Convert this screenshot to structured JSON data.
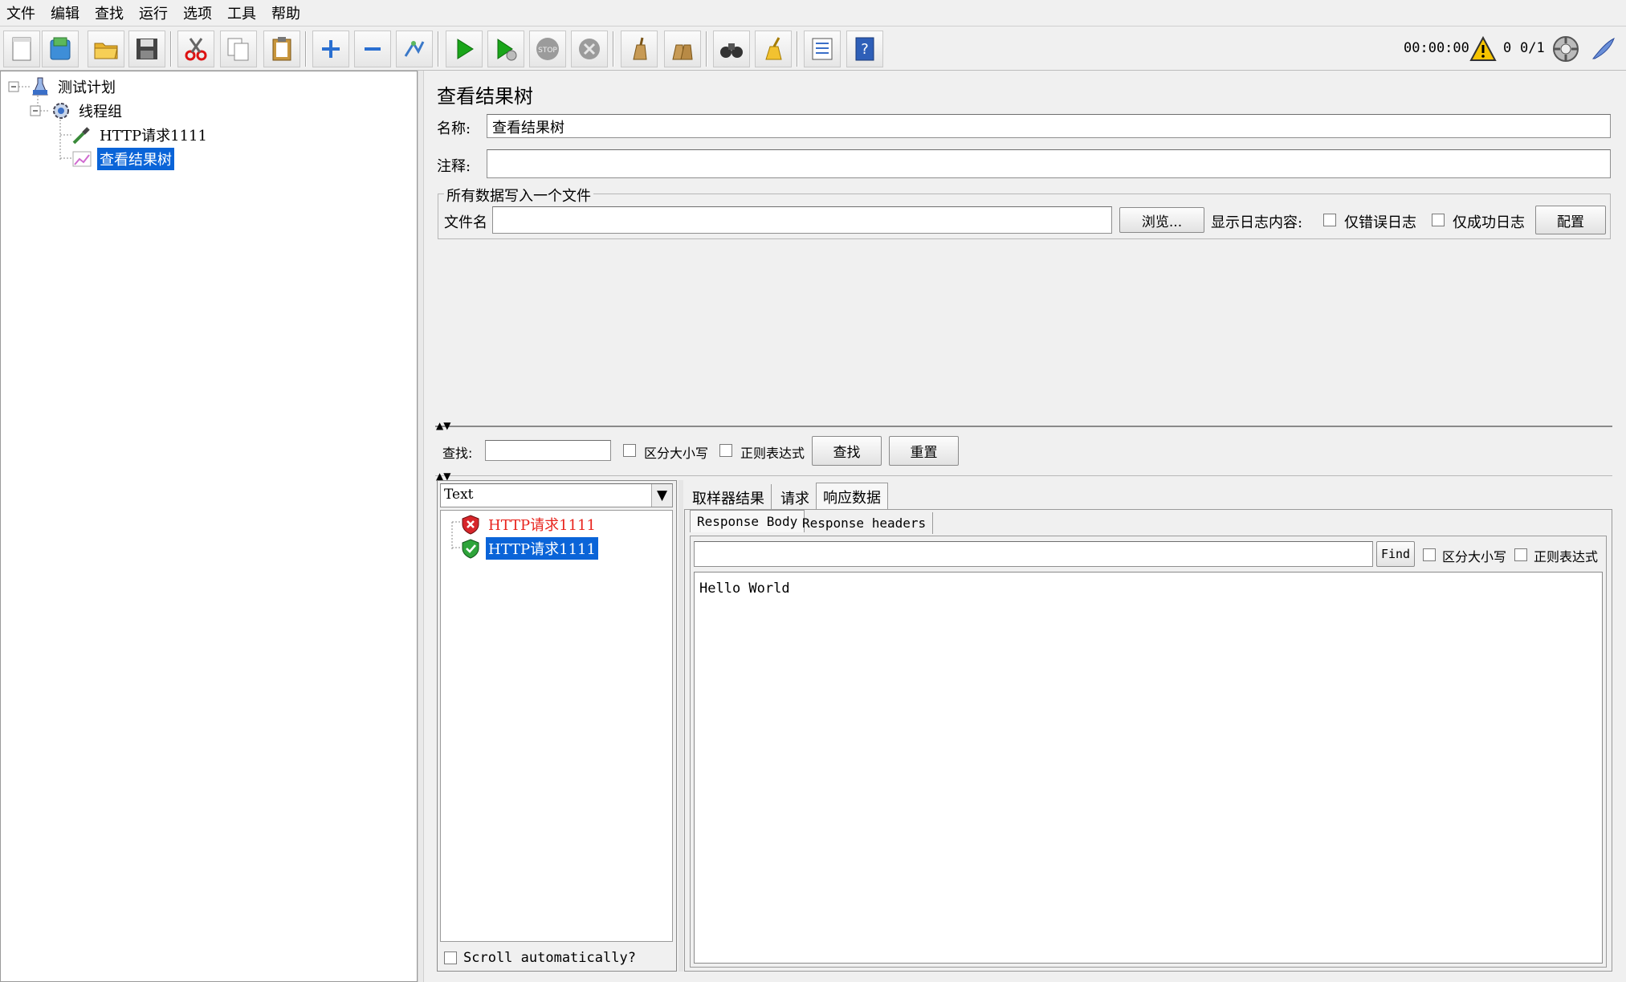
{
  "menu": [
    "文件",
    "编辑",
    "查找",
    "运行",
    "选项",
    "工具",
    "帮助"
  ],
  "toolbar": {
    "timer": "00:00:00",
    "warn_count": "0",
    "threads": "0/1"
  },
  "tree": {
    "test_plan": "测试计划",
    "thread_group": "线程组",
    "http_request": "HTTP请求1111",
    "result_tree": "查看结果树"
  },
  "panel": {
    "title": "查看结果树",
    "name_label": "名称:",
    "name_value": "查看结果树",
    "comment_label": "注释:",
    "comment_value": "",
    "file_group_title": "所有数据写入一个文件",
    "filename_label": "文件名",
    "filename_value": "",
    "browse_button": "浏览...",
    "log_display_label": "显示日志内容:",
    "errors_only_label": "仅错误日志",
    "success_only_label": "仅成功日志",
    "config_button": "配置"
  },
  "search": {
    "label": "查找:",
    "value": "",
    "case_label": "区分大小写",
    "regex_label": "正则表达式",
    "find_button": "查找",
    "reset_button": "重置"
  },
  "results": {
    "renderer_value": "Text",
    "items": [
      {
        "label": "HTTP请求1111",
        "status": "error"
      },
      {
        "label": "HTTP请求1111",
        "status": "success"
      }
    ],
    "scroll_label": "Scroll automatically?"
  },
  "detail_tabs": [
    "取样器结果",
    "请求",
    "响应数据"
  ],
  "response_tabs": [
    "Response Body",
    "Response headers"
  ],
  "response": {
    "find_value": "",
    "find_button": "Find",
    "case_label": "区分大小写",
    "regex_label": "正则表达式",
    "body": "Hello World"
  },
  "colors": {
    "selection": "#0a64d8",
    "error_text": "#e8231c",
    "run_green": "#1aa51a"
  }
}
